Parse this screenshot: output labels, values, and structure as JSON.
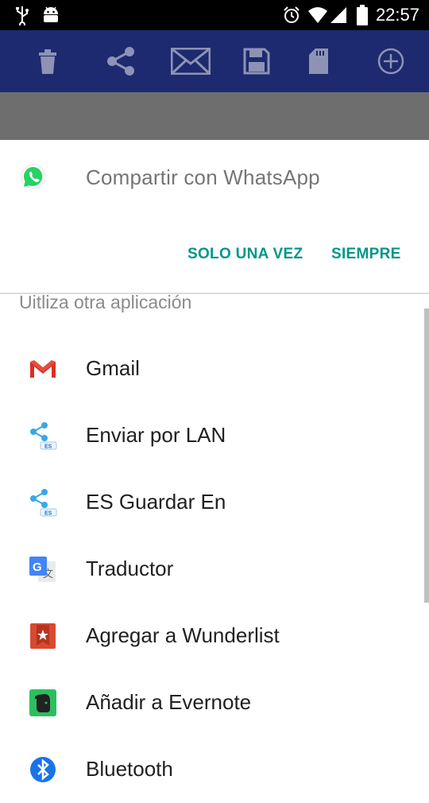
{
  "status_bar": {
    "time": "22:57",
    "icons": [
      "usb-icon",
      "android-icon",
      "alarm-icon",
      "wifi-icon",
      "signal-icon",
      "battery-icon"
    ]
  },
  "toolbar": {
    "icons": [
      "trash-icon",
      "share-icon",
      "mail-icon",
      "save-icon",
      "sd-card-icon",
      "add-circle-icon"
    ]
  },
  "share_sheet": {
    "title": "Compartir con WhatsApp",
    "just_once": "SOLO UNA VEZ",
    "always": "SIEMPRE",
    "other_apps_label": "Uitliza otra aplicación",
    "apps": [
      {
        "label": "Gmail",
        "icon": "gmail-icon"
      },
      {
        "label": "Enviar por LAN",
        "icon": "es-share-icon"
      },
      {
        "label": "ES Guardar En",
        "icon": "es-share-icon"
      },
      {
        "label": "Traductor",
        "icon": "google-translate-icon"
      },
      {
        "label": "Agregar a Wunderlist",
        "icon": "wunderlist-icon"
      },
      {
        "label": "Añadir a Evernote",
        "icon": "evernote-icon"
      },
      {
        "label": "Bluetooth",
        "icon": "bluetooth-icon"
      }
    ]
  },
  "colors": {
    "accent": "#009688",
    "toolbar": "#1d2a6f",
    "whatsapp": "#25d366"
  }
}
